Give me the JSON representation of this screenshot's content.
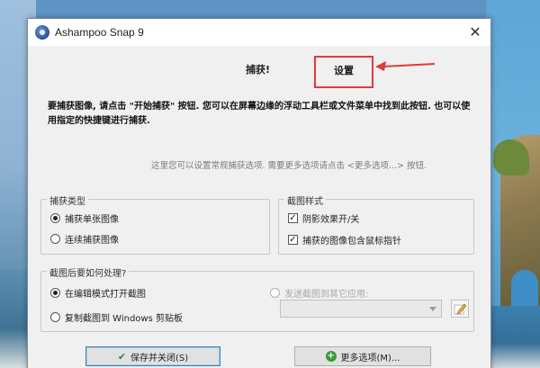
{
  "window": {
    "title": "Ashampoo Snap 9",
    "close_glyph": "✕"
  },
  "tabs": {
    "capture": "捕获!",
    "settings": "设置"
  },
  "intro": "要捕获图像, 请点击 \"开始捕获\" 按钮. 您可以在屏幕边缘的浮动工具栏或文件菜单中找到此按钮. 也可以使用指定的快捷键进行捕获.",
  "hint": "这里您可以设置常规捕获选项. 需要更多选项请点击 <更多选项...> 按钮.",
  "capture_type": {
    "title": "捕获类型",
    "options": [
      {
        "label": "捕获单张图像",
        "checked": true
      },
      {
        "label": "连续捕获图像",
        "checked": false
      }
    ]
  },
  "screenshot_style": {
    "title": "截图样式",
    "options": [
      {
        "label": "阴影效果开/关",
        "checked": true
      },
      {
        "label": "捕获的图像包含鼠标指针",
        "checked": true
      }
    ]
  },
  "after_capture": {
    "title": "截图后要如何处理?",
    "options": [
      {
        "label": "在编辑模式打开截图",
        "checked": true
      },
      {
        "label": "复制截图到 Windows 剪贴板",
        "checked": false
      }
    ],
    "send_to": {
      "label": "发送截图到其它应用:",
      "enabled": false
    },
    "dropdown_value": ""
  },
  "buttons": {
    "save_close": "保存并关闭(S)",
    "more_options": "更多选项(M)..."
  },
  "icons": {
    "app": "ashampoo-snap-icon",
    "close": "close-icon",
    "ok": "checkmark-icon",
    "more": "plus-icon",
    "edit": "edit-icon"
  },
  "colors": {
    "highlight_border": "#e23a3a",
    "window_bg": "#f0f0f0",
    "primary_button_border": "#3c7fb1"
  }
}
